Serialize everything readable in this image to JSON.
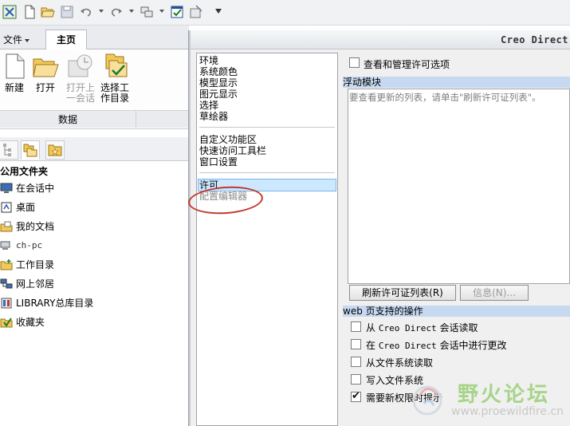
{
  "quick_access": {
    "icons": [
      "app-icon",
      "new-icon",
      "open-icon",
      "save-icon",
      "undo-icon",
      "redo-icon",
      "window-icon",
      "check-window-icon",
      "close-window-icon",
      "customize-icon"
    ]
  },
  "ribbon": {
    "file_tab": "文件",
    "home_tab": "主页",
    "buttons": {
      "new": "新建",
      "open": "打开",
      "open_last_1": "打开上",
      "open_last_2": "一会话",
      "select_wd_1": "选择工",
      "select_wd_2": "作目录"
    },
    "group_label": "数据"
  },
  "navigator": {
    "title": "公用文件夹",
    "items": [
      {
        "label": "在会话中",
        "icon": "monitor-icon"
      },
      {
        "label": "桌面",
        "icon": "desktop-icon"
      },
      {
        "label": "我的文档",
        "icon": "documents-icon"
      },
      {
        "label": "ch-pc",
        "icon": "computer-icon"
      },
      {
        "label": "工作目录",
        "icon": "folder-icon"
      },
      {
        "label": "网上邻居",
        "icon": "network-icon"
      },
      {
        "label": "LIBRARY总库目录",
        "icon": "library-icon"
      },
      {
        "label": "收藏夹",
        "icon": "favorites-icon"
      }
    ]
  },
  "options": {
    "window_title": "Creo Direct",
    "categories_group1": [
      "环境",
      "系统颜色",
      "模型显示",
      "图元显示",
      "选择",
      "草绘器"
    ],
    "categories_group2": [
      "自定义功能区",
      "快速访问工具栏",
      "窗口设置"
    ],
    "categories_group3": [
      "许可",
      "配置编辑器"
    ],
    "selected_category": "许可",
    "view_manage_label": "查看和管理许可选项",
    "floating_header": "浮动模块",
    "floating_hint": "要查看更新的列表，请单击\"刷新许可证列表\"。",
    "refresh_button": "刷新许可证列表(R)",
    "info_button": "信息(N)...",
    "web_header": "web 页支持的操作",
    "web_items": [
      {
        "pre": "从 ",
        "mono": "Creo Direct",
        "post": " 会话读取",
        "checked": false
      },
      {
        "pre": "在 ",
        "mono": "Creo Direct",
        "post": " 会话中进行更改",
        "checked": false
      },
      {
        "pre": "从文件系统读取",
        "mono": "",
        "post": "",
        "checked": false
      },
      {
        "pre": "写入文件系统",
        "mono": "",
        "post": "",
        "checked": false
      },
      {
        "pre": "需要新权限时提示",
        "mono": "",
        "post": "",
        "checked": true
      }
    ]
  },
  "watermark": {
    "text": "野火论坛",
    "url": "www.proewildfire.cn"
  },
  "colors": {
    "highlight": "#cce8ff",
    "section_header": "#c6d9f1",
    "annotation_circle": "#c0392b",
    "watermark_green": "#a8d48a"
  }
}
